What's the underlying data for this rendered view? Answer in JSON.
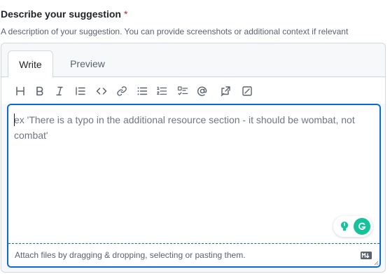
{
  "field": {
    "label": "Describe your suggestion",
    "required_mark": "*",
    "description": "A description of your suggestion. You can provide screenshots or additional context if relevant"
  },
  "tabs": [
    {
      "label": "Write",
      "active": true
    },
    {
      "label": "Preview",
      "active": false
    }
  ],
  "toolbar": {
    "icons": [
      "heading-icon",
      "bold-icon",
      "italic-icon",
      "quote-icon",
      "code-icon",
      "link-icon",
      "unordered-list-icon",
      "ordered-list-icon",
      "task-list-icon",
      "mention-icon",
      "reference-icon",
      "saved-replies-icon"
    ]
  },
  "editor": {
    "placeholder": "ex 'There is a typo in the additional resource section - it should be wombat, not combat'",
    "value": ""
  },
  "attach": {
    "text": "Attach files by dragging & dropping, selecting or pasting them."
  },
  "colors": {
    "accent": "#0969da",
    "required": "#cf222e",
    "grammarly": "#15c39a"
  }
}
